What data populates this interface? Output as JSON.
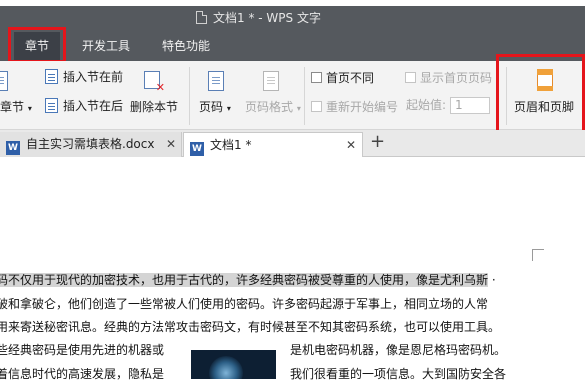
{
  "window": {
    "title": "文档1 * - WPS 文字"
  },
  "menu_tabs": [
    {
      "label": "章节",
      "active": true
    },
    {
      "label": "开发工具",
      "active": false
    },
    {
      "label": "特色功能",
      "active": false
    }
  ],
  "ribbon": {
    "chapter_label": "章节",
    "insert_section_before": "插入节在前",
    "insert_section_after": "插入节在后",
    "delete_section": "删除本节",
    "page_number": "页码",
    "page_number_format": "页码格式",
    "first_page_different": "首页不同",
    "show_first_page_number": "显示首页页码",
    "restart_numbering": "重新开始编号",
    "start_value_label": "起始值:",
    "start_value": "1",
    "header_footer": "页眉和页脚"
  },
  "doc_tabs": [
    {
      "label": "自主实习需填表格.docx",
      "icon": "W",
      "active": false
    },
    {
      "label": "文档1 *",
      "icon": "W",
      "active": true
    }
  ],
  "document": {
    "lines": [
      {
        "highlight": "码不仅用于现代的加密技术，也用于古代的，许多经典密码被受尊重的人使用，像是尤利乌斯"
      },
      {
        "text": "破和拿破仑，他们创造了一些常被人们使用的密码。许多密码起源于军事上，相同立场的人常"
      },
      {
        "text": "用来寄送秘密讯息。经典的方法常攻击密码文，有时候甚至不知其密码系统，也可以使用工具。"
      },
      {
        "left": "些经典密码是使用先进的机器或",
        "right": "是机电密码机器，像是恩尼格玛密码机。"
      },
      {
        "left": "着信息时代的高速发展，隐私是",
        "right": "我们很看重的一项信息。大到国防安全各"
      }
    ]
  },
  "colors": {
    "titlebar": "#55595e",
    "ribbon_bg": "#f3f3f3",
    "annotation_red": "#e5151b",
    "highlight": "#d4d4d4"
  }
}
